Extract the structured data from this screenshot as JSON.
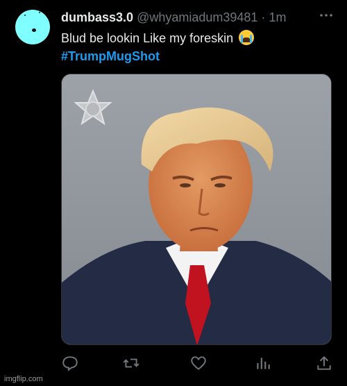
{
  "tweet": {
    "display_name": "dumbass3.0",
    "handle": "@whyamiadum39481",
    "separator": "·",
    "time": "1m",
    "text": "Blud be lookin Like my foreskin",
    "emoji": "loudly-crying-face",
    "hashtag": "#TrumpMugShot"
  },
  "actions": [
    "reply-icon",
    "retweet-icon",
    "like-icon",
    "views-icon",
    "share-icon"
  ],
  "watermark": "imgflip.com",
  "colors": {
    "background": "#000000",
    "link": "#1d9bf0",
    "muted": "#71767b",
    "avatar": "#7fffff"
  }
}
